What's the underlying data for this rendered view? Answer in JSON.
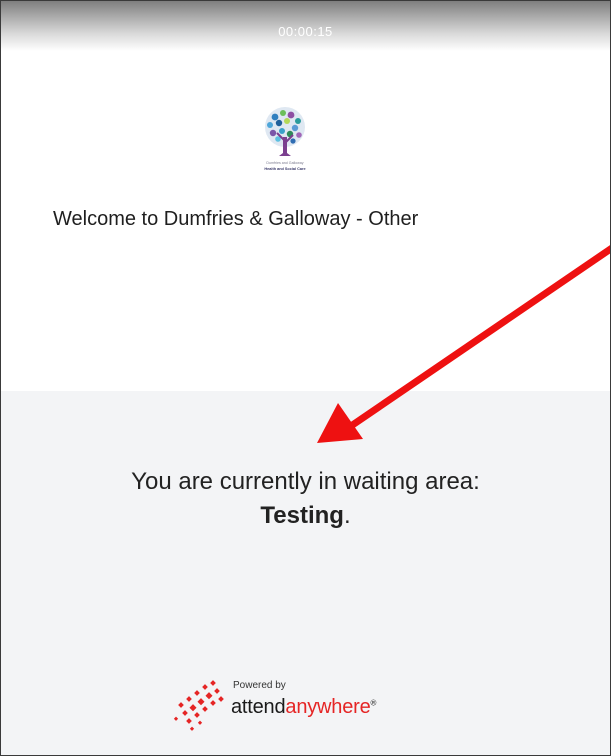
{
  "timer": {
    "elapsed": "00:00:15"
  },
  "organization": {
    "logo_icon": "tree-logo-icon",
    "logo_text_line1": "Dumfries and Galloway",
    "logo_text_line2": "Health and Social Care"
  },
  "welcome": {
    "message": "Welcome to Dumfries & Galloway - Other"
  },
  "waiting": {
    "prefix": "You are currently in waiting area:",
    "area_name": "Testing",
    "suffix": "."
  },
  "branding": {
    "powered_by": "Powered by",
    "name_part1": "attend",
    "name_part2": "anywhere",
    "trademark": "®",
    "icon": "attendanywhere-logo-icon"
  },
  "colors": {
    "accent_red": "#e52525",
    "waiting_bg": "#f3f4f6",
    "text_dark": "#222222"
  }
}
